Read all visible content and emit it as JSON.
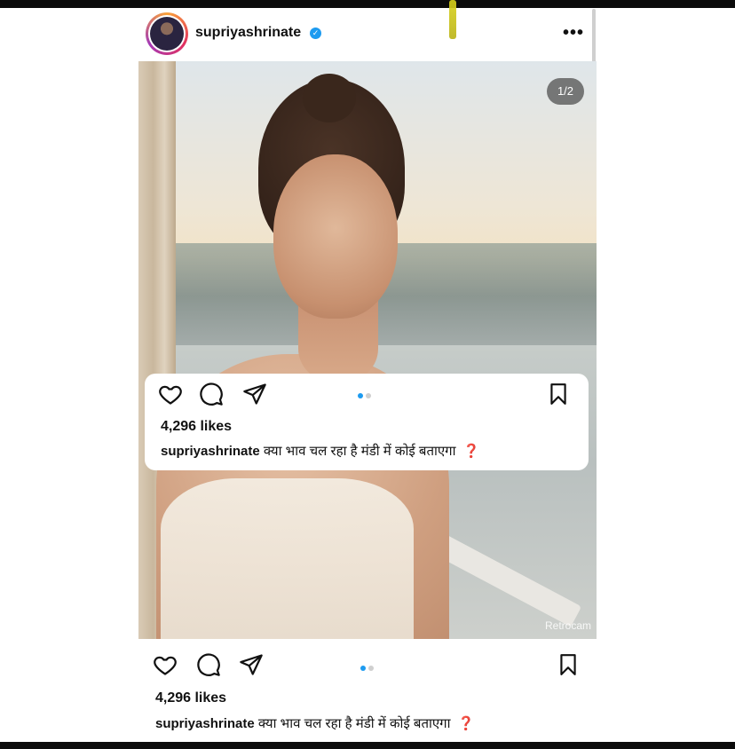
{
  "post": {
    "username": "supriyashrinate",
    "more_label": "•••",
    "counter": "1/2",
    "watermark": "Retrocam",
    "likes": "4,296 likes",
    "caption_user": "supriyashrinate",
    "caption_text": "क्या भाव चल रहा है मंडी में कोई बताएगा",
    "caption_emoji": "❓"
  },
  "icons": [
    "heart-icon",
    "comment-icon",
    "share-icon",
    "bookmark-icon",
    "verified-icon"
  ],
  "colors": {
    "accent": "#1d9bf0",
    "question": "#e03131"
  }
}
